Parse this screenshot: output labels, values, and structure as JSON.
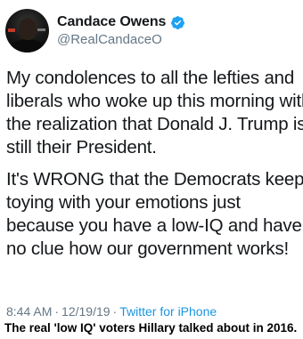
{
  "author": {
    "display_name": "Candace Owens",
    "handle": "@RealCandaceO",
    "verified": true,
    "avatar_icon": "profile-photo"
  },
  "tweet": {
    "paragraph1": [
      "My condolences to all the lefties and",
      "liberals who woke up this morning with",
      "the realization that Donald J. Trump is",
      "still their President."
    ],
    "paragraph2": [
      "It's WRONG that the Democrats keep",
      "toying with your emotions just",
      "because you have a low-IQ and have",
      "no clue how our government works!"
    ]
  },
  "meta": {
    "time": "8:44 AM",
    "separator": "·",
    "date": "12/19/19",
    "source": "Twitter for iPhone"
  },
  "caption": "The real 'low IQ' voters Hillary talked about in 2016.",
  "colors": {
    "verified_blue": "#1da1f2",
    "link_blue": "#1b95e0",
    "secondary_gray": "#657786",
    "text_dark": "#14171a"
  }
}
